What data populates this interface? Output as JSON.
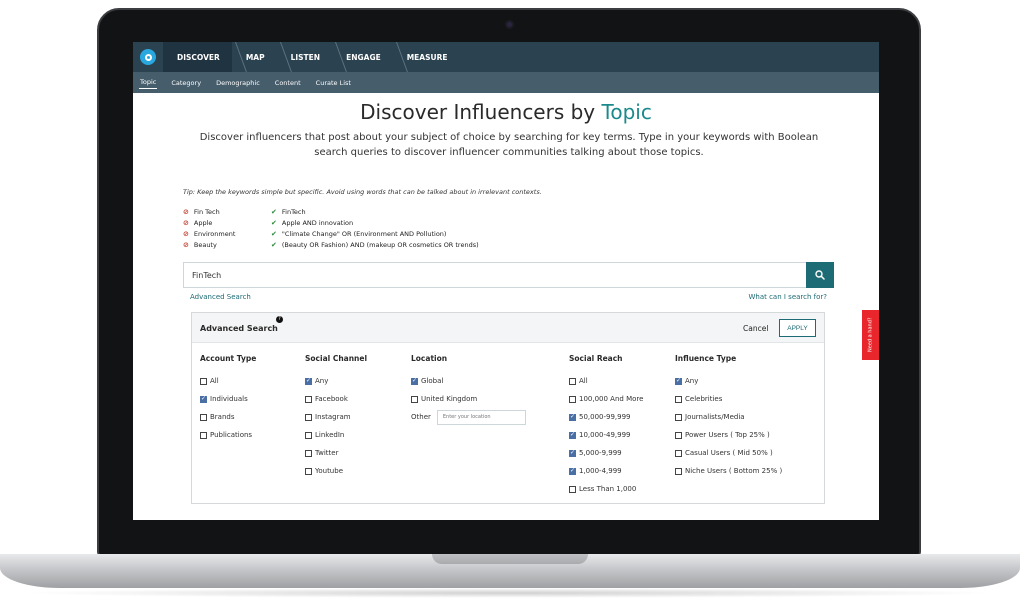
{
  "nav": {
    "items": [
      "DISCOVER",
      "MAP",
      "LISTEN",
      "ENGAGE",
      "MEASURE"
    ],
    "active": "DISCOVER"
  },
  "subnav": {
    "items": [
      "Topic",
      "Category",
      "Demographic",
      "Content",
      "Curate List"
    ],
    "active": "Topic"
  },
  "page": {
    "title_main": "Discover Influencers by ",
    "title_accent": "Topic",
    "description": "Discover influencers that post about your subject of choice by searching for key terms. Type in your keywords with Boolean search queries to discover influencer communities talking about those topics.",
    "tip": "Tip: Keep the keywords simple but specific. Avoid using words that can be talked about in irrelevant contexts.",
    "examples": [
      {
        "bad": "Fin Tech",
        "good": "FinTech"
      },
      {
        "bad": "Apple",
        "good": "Apple AND innovation"
      },
      {
        "bad": "Environment",
        "good": "\"Climate Change\" OR (Environment AND Pollution)"
      },
      {
        "bad": "Beauty",
        "good": "(Beauty OR Fashion) AND (makeup OR cosmetics OR trends)"
      }
    ]
  },
  "search": {
    "value": "FinTech",
    "advanced_link": "Advanced Search",
    "help_link": "What can I search for?"
  },
  "advanced": {
    "title": "Advanced Search",
    "help_badge": "?",
    "cancel_label": "Cancel",
    "apply_label": "APPLY",
    "account_type": {
      "heading": "Account Type",
      "options": [
        {
          "label": "All",
          "checked": false
        },
        {
          "label": "Individuals",
          "checked": true
        },
        {
          "label": "Brands",
          "checked": false
        },
        {
          "label": "Publications",
          "checked": false
        }
      ]
    },
    "social_channel": {
      "heading": "Social Channel",
      "options": [
        {
          "label": "Any",
          "checked": true
        },
        {
          "label": "Facebook",
          "checked": false
        },
        {
          "label": "Instagram",
          "checked": false
        },
        {
          "label": "LinkedIn",
          "checked": false
        },
        {
          "label": "Twitter",
          "checked": false
        },
        {
          "label": "Youtube",
          "checked": false
        }
      ]
    },
    "location": {
      "heading": "Location",
      "options": [
        {
          "label": "Global",
          "checked": true
        },
        {
          "label": "United Kingdom",
          "checked": false
        }
      ],
      "other_label": "Other",
      "other_placeholder": "Enter your location"
    },
    "social_reach": {
      "heading": "Social Reach",
      "options": [
        {
          "label": "All",
          "checked": false
        },
        {
          "label": "100,000 And More",
          "checked": false
        },
        {
          "label": "50,000-99,999",
          "checked": true
        },
        {
          "label": "10,000-49,999",
          "checked": true
        },
        {
          "label": "5,000-9,999",
          "checked": true
        },
        {
          "label": "1,000-4,999",
          "checked": true
        },
        {
          "label": "Less Than 1,000",
          "checked": false
        }
      ]
    },
    "influence_type": {
      "heading": "Influence Type",
      "options": [
        {
          "label": "Any",
          "checked": true
        },
        {
          "label": "Celebrities",
          "checked": false
        },
        {
          "label": "Journalists/Media",
          "checked": false
        },
        {
          "label": "Power Users ( Top 25% )",
          "checked": false
        },
        {
          "label": "Casual Users ( Mid 50% )",
          "checked": false
        },
        {
          "label": "Niche Users ( Bottom 25% )",
          "checked": false
        }
      ]
    }
  },
  "help_tab": "Need a hand?",
  "colors": {
    "accent": "#1b8a8c",
    "nav": "#2b4250",
    "subnav": "#465d6b",
    "button": "#1c6b75",
    "help": "#e8262b"
  }
}
